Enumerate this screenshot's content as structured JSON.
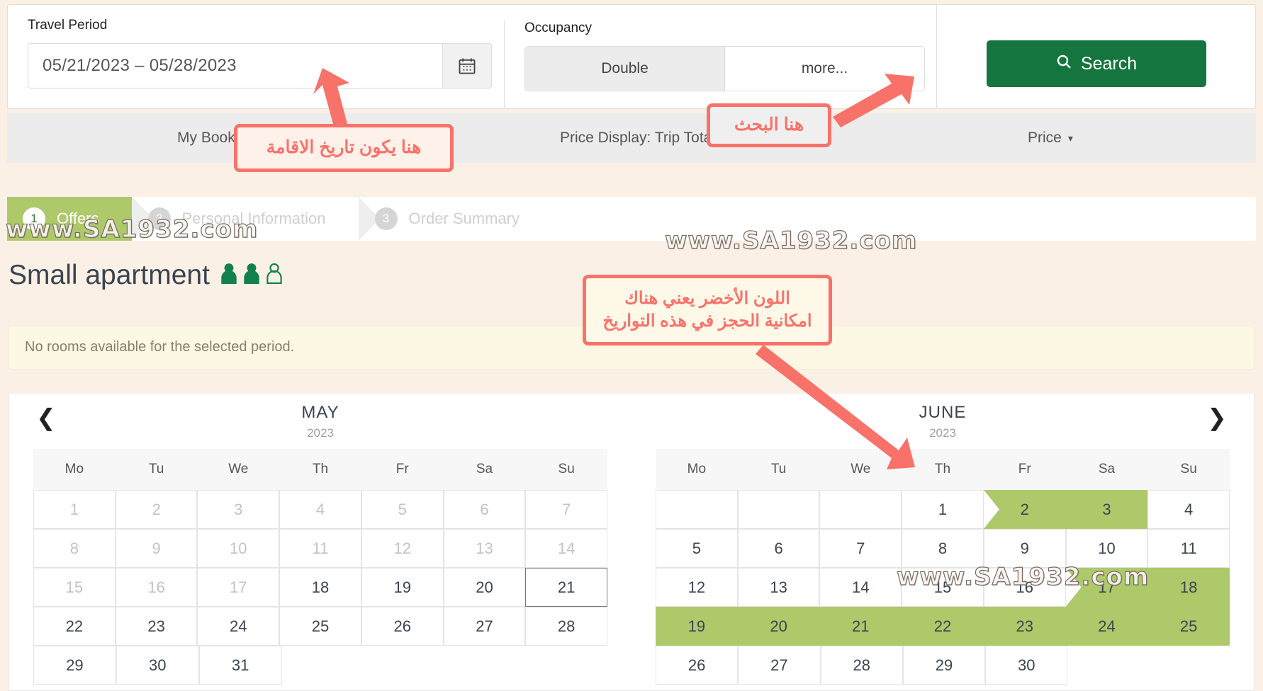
{
  "searchbar": {
    "travel": {
      "label": "Travel Period",
      "value": "05/21/2023 – 05/28/2023",
      "calendar_icon": "calendar-icon"
    },
    "occupancy": {
      "label": "Occupancy",
      "options": [
        "Double",
        "more..."
      ],
      "selected": "Double"
    },
    "search_button": {
      "label": "Search",
      "icon": "search-icon",
      "color": "#15753f"
    }
  },
  "navbar": {
    "my_booking": "My Booking",
    "price_display": "Price Display: Trip Total",
    "middle_caret": "▾",
    "price": "Price",
    "price_caret": "▾"
  },
  "steps": [
    {
      "num": "1",
      "label": "Offers",
      "state": "active"
    },
    {
      "num": "2",
      "label": "Personal Information",
      "state": "idle"
    },
    {
      "num": "3",
      "label": "Order Summary",
      "state": "idle"
    }
  ],
  "apartment": {
    "title": "Small apartment",
    "occupancy_icons": [
      "person-filled-icon",
      "person-filled-icon",
      "person-outline-icon"
    ],
    "icon_color": "#12804a"
  },
  "alert": {
    "message": "No rooms available for the selected period."
  },
  "calendar": {
    "prev_icon": "chevron-left-icon",
    "next_icon": "chevron-right-icon",
    "dow": [
      "Mo",
      "Tu",
      "We",
      "Th",
      "Fr",
      "Sa",
      "Su"
    ],
    "available_color": "#aec96a",
    "months": [
      {
        "name": "MAY",
        "year": "2023",
        "weeks": [
          [
            {
              "d": "1",
              "s": "muted"
            },
            {
              "d": "2",
              "s": "muted"
            },
            {
              "d": "3",
              "s": "muted"
            },
            {
              "d": "4",
              "s": "muted"
            },
            {
              "d": "5",
              "s": "muted"
            },
            {
              "d": "6",
              "s": "muted"
            },
            {
              "d": "7",
              "s": "muted"
            }
          ],
          [
            {
              "d": "8",
              "s": "muted"
            },
            {
              "d": "9",
              "s": "muted"
            },
            {
              "d": "10",
              "s": "muted"
            },
            {
              "d": "11",
              "s": "muted"
            },
            {
              "d": "12",
              "s": "muted"
            },
            {
              "d": "13",
              "s": "muted"
            },
            {
              "d": "14",
              "s": "muted"
            }
          ],
          [
            {
              "d": "15",
              "s": "muted"
            },
            {
              "d": "16",
              "s": "muted"
            },
            {
              "d": "17",
              "s": "muted"
            },
            {
              "d": "18",
              "s": "normal"
            },
            {
              "d": "19",
              "s": "normal"
            },
            {
              "d": "20",
              "s": "normal"
            },
            {
              "d": "21",
              "s": "boxed"
            }
          ],
          [
            {
              "d": "22",
              "s": "normal"
            },
            {
              "d": "23",
              "s": "normal"
            },
            {
              "d": "24",
              "s": "normal"
            },
            {
              "d": "25",
              "s": "normal"
            },
            {
              "d": "26",
              "s": "normal"
            },
            {
              "d": "27",
              "s": "normal"
            },
            {
              "d": "28",
              "s": "normal"
            }
          ],
          [
            {
              "d": "29",
              "s": "normal"
            },
            {
              "d": "30",
              "s": "normal"
            },
            {
              "d": "31",
              "s": "normal"
            },
            {
              "d": "",
              "s": "blank"
            },
            {
              "d": "",
              "s": "blank"
            },
            {
              "d": "",
              "s": "blank"
            },
            {
              "d": "",
              "s": "blank"
            }
          ]
        ]
      },
      {
        "name": "JUNE",
        "year": "2023",
        "weeks": [
          [
            {
              "d": "",
              "s": "empty"
            },
            {
              "d": "",
              "s": "empty"
            },
            {
              "d": "",
              "s": "empty"
            },
            {
              "d": "1",
              "s": "normal"
            },
            {
              "d": "2",
              "s": "avail-start"
            },
            {
              "d": "3",
              "s": "avail-end"
            },
            {
              "d": "4",
              "s": "normal"
            }
          ],
          [
            {
              "d": "5",
              "s": "normal"
            },
            {
              "d": "6",
              "s": "normal"
            },
            {
              "d": "7",
              "s": "normal"
            },
            {
              "d": "8",
              "s": "normal"
            },
            {
              "d": "9",
              "s": "normal"
            },
            {
              "d": "10",
              "s": "normal"
            },
            {
              "d": "11",
              "s": "normal"
            }
          ],
          [
            {
              "d": "12",
              "s": "normal"
            },
            {
              "d": "13",
              "s": "normal"
            },
            {
              "d": "14",
              "s": "normal"
            },
            {
              "d": "15",
              "s": "normal"
            },
            {
              "d": "16",
              "s": "normal"
            },
            {
              "d": "17",
              "s": "avail-start"
            },
            {
              "d": "18",
              "s": "avail"
            }
          ],
          [
            {
              "d": "19",
              "s": "avail"
            },
            {
              "d": "20",
              "s": "avail"
            },
            {
              "d": "21",
              "s": "avail"
            },
            {
              "d": "22",
              "s": "avail"
            },
            {
              "d": "23",
              "s": "avail"
            },
            {
              "d": "24",
              "s": "avail"
            },
            {
              "d": "25",
              "s": "avail"
            }
          ],
          [
            {
              "d": "26",
              "s": "normal"
            },
            {
              "d": "27",
              "s": "normal"
            },
            {
              "d": "28",
              "s": "normal"
            },
            {
              "d": "29",
              "s": "normal"
            },
            {
              "d": "30",
              "s": "normal"
            },
            {
              "d": "",
              "s": "blank"
            },
            {
              "d": "",
              "s": "blank"
            }
          ]
        ]
      }
    ]
  },
  "annotations": {
    "date": "هنا يكون تاريخ الاقامة",
    "search": "هنا البحث",
    "green_line1": "اللون الأخضر يعني هناك",
    "green_line2": "امكانية الحجز في هذه التواريخ",
    "color": "#f8726a"
  },
  "watermarks": {
    "text": "www.SA1932.com"
  }
}
